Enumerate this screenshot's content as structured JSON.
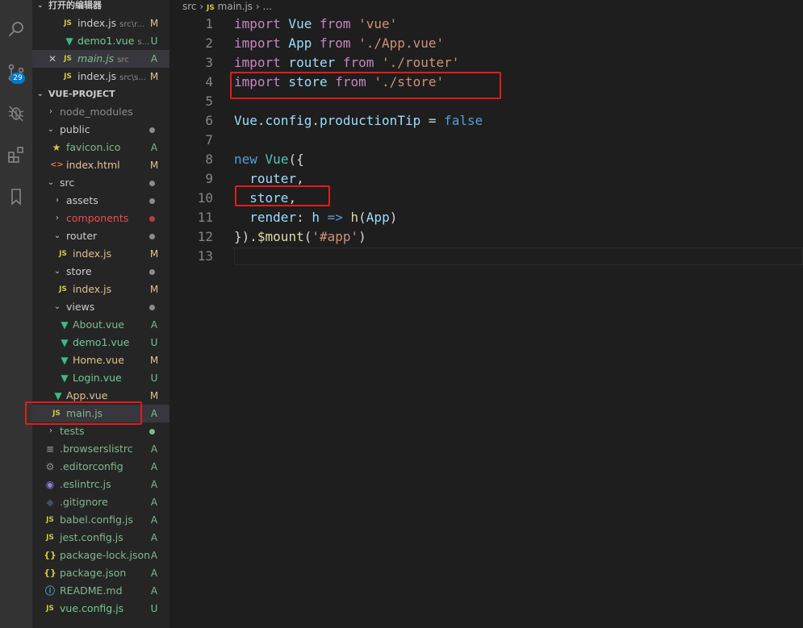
{
  "activity_bar": {
    "icons": [
      "search-icon",
      "source-control-icon",
      "debug-icon",
      "extensions-icon",
      "bookmark-icon"
    ],
    "scm_badge": "29"
  },
  "open_editors": {
    "title": "打开的编辑器",
    "items": [
      {
        "icon": "JS",
        "name": "index.js",
        "path": "src\\r...",
        "status": "M"
      },
      {
        "icon": "vue",
        "name": "demo1.vue",
        "path": "s...",
        "status": "U"
      },
      {
        "icon": "JS",
        "name": "main.js",
        "path": "src",
        "status": "A",
        "close": "✕"
      },
      {
        "icon": "JS",
        "name": "index.js",
        "path": "src\\s...",
        "status": "M"
      }
    ]
  },
  "explorer": {
    "title": "VUE-PROJECT",
    "items": [
      {
        "name": "node_modules",
        "status": ""
      },
      {
        "name": "public",
        "status": "●"
      },
      {
        "name": "favicon.ico",
        "status": "A"
      },
      {
        "name": "index.html",
        "status": "M"
      },
      {
        "name": "src",
        "status": "●"
      },
      {
        "name": "assets",
        "status": "●"
      },
      {
        "name": "components",
        "status": "●"
      },
      {
        "name": "router",
        "status": "●"
      },
      {
        "name": "index.js",
        "status": "M"
      },
      {
        "name": "store",
        "status": "●"
      },
      {
        "name": "index.js",
        "status": "M"
      },
      {
        "name": "views",
        "status": "●"
      },
      {
        "name": "About.vue",
        "status": "A"
      },
      {
        "name": "demo1.vue",
        "status": "U"
      },
      {
        "name": "Home.vue",
        "status": "M"
      },
      {
        "name": "Login.vue",
        "status": "U"
      },
      {
        "name": "App.vue",
        "status": "M"
      },
      {
        "name": "main.js",
        "status": "A"
      },
      {
        "name": "tests",
        "status": "●"
      },
      {
        "name": ".browserslistrc",
        "status": "A"
      },
      {
        "name": ".editorconfig",
        "status": "A"
      },
      {
        "name": ".eslintrc.js",
        "status": "A"
      },
      {
        "name": ".gitignore",
        "status": "A"
      },
      {
        "name": "babel.config.js",
        "status": "A"
      },
      {
        "name": "jest.config.js",
        "status": "A"
      },
      {
        "name": "package-lock.json",
        "status": "A"
      },
      {
        "name": "package.json",
        "status": "A"
      },
      {
        "name": "README.md",
        "status": "A"
      },
      {
        "name": "vue.config.js",
        "status": "U"
      }
    ]
  },
  "breadcrumb": {
    "folder": "src",
    "sep1": "›",
    "icon": "JS",
    "file": "main.js",
    "sep2": "›",
    "more": "..."
  },
  "editor": {
    "line_numbers": [
      "1",
      "2",
      "3",
      "4",
      "5",
      "6",
      "7",
      "8",
      "9",
      "10",
      "11",
      "12",
      "13"
    ],
    "lines": [
      [
        {
          "t": "import",
          "c": "kw"
        },
        {
          "t": " Vue ",
          "c": "var"
        },
        {
          "t": "from",
          "c": "kw"
        },
        {
          "t": " ",
          "c": ""
        },
        {
          "t": "'vue'",
          "c": "str"
        }
      ],
      [
        {
          "t": "import",
          "c": "kw"
        },
        {
          "t": " App ",
          "c": "var"
        },
        {
          "t": "from",
          "c": "kw"
        },
        {
          "t": " ",
          "c": ""
        },
        {
          "t": "'./App.vue'",
          "c": "str"
        }
      ],
      [
        {
          "t": "import",
          "c": "kw"
        },
        {
          "t": " router ",
          "c": "var"
        },
        {
          "t": "from",
          "c": "kw"
        },
        {
          "t": " ",
          "c": ""
        },
        {
          "t": "'./router'",
          "c": "str"
        }
      ],
      [
        {
          "t": "import",
          "c": "kw"
        },
        {
          "t": " store ",
          "c": "var"
        },
        {
          "t": "from",
          "c": "kw"
        },
        {
          "t": " ",
          "c": ""
        },
        {
          "t": "'./store'",
          "c": "str"
        }
      ],
      [],
      [
        {
          "t": "Vue",
          "c": "var"
        },
        {
          "t": ".",
          "c": ""
        },
        {
          "t": "config",
          "c": "var"
        },
        {
          "t": ".",
          "c": ""
        },
        {
          "t": "productionTip",
          "c": "var"
        },
        {
          "t": " = ",
          "c": ""
        },
        {
          "t": "false",
          "c": "kwb"
        }
      ],
      [],
      [
        {
          "t": "new",
          "c": "kwb"
        },
        {
          "t": " ",
          "c": ""
        },
        {
          "t": "Vue",
          "c": "cls"
        },
        {
          "t": "({",
          "c": ""
        }
      ],
      [
        {
          "t": "  ",
          "c": ""
        },
        {
          "t": "router",
          "c": "var"
        },
        {
          "t": ",",
          "c": ""
        }
      ],
      [
        {
          "t": "  ",
          "c": ""
        },
        {
          "t": "store",
          "c": "var"
        },
        {
          "t": ",",
          "c": ""
        }
      ],
      [
        {
          "t": "  ",
          "c": ""
        },
        {
          "t": "render",
          "c": "var"
        },
        {
          "t": ": ",
          "c": ""
        },
        {
          "t": "h",
          "c": "var"
        },
        {
          "t": " ",
          "c": ""
        },
        {
          "t": "=>",
          "c": "kwb"
        },
        {
          "t": " ",
          "c": ""
        },
        {
          "t": "h",
          "c": "fn"
        },
        {
          "t": "(",
          "c": ""
        },
        {
          "t": "App",
          "c": "var"
        },
        {
          "t": ")",
          "c": ""
        }
      ],
      [
        {
          "t": "}).",
          "c": ""
        },
        {
          "t": "$mount",
          "c": "fn"
        },
        {
          "t": "(",
          "c": ""
        },
        {
          "t": "'#app'",
          "c": "str"
        },
        {
          "t": ")",
          "c": ""
        }
      ],
      []
    ]
  },
  "colors": {
    "status_M": "#e2c08d",
    "status_U": "#73c991",
    "status_A": "#81b88b",
    "dot_normal": "#8c8c8c",
    "dot_error": "#f14c4c",
    "highlight_red": "#e51a1a"
  }
}
